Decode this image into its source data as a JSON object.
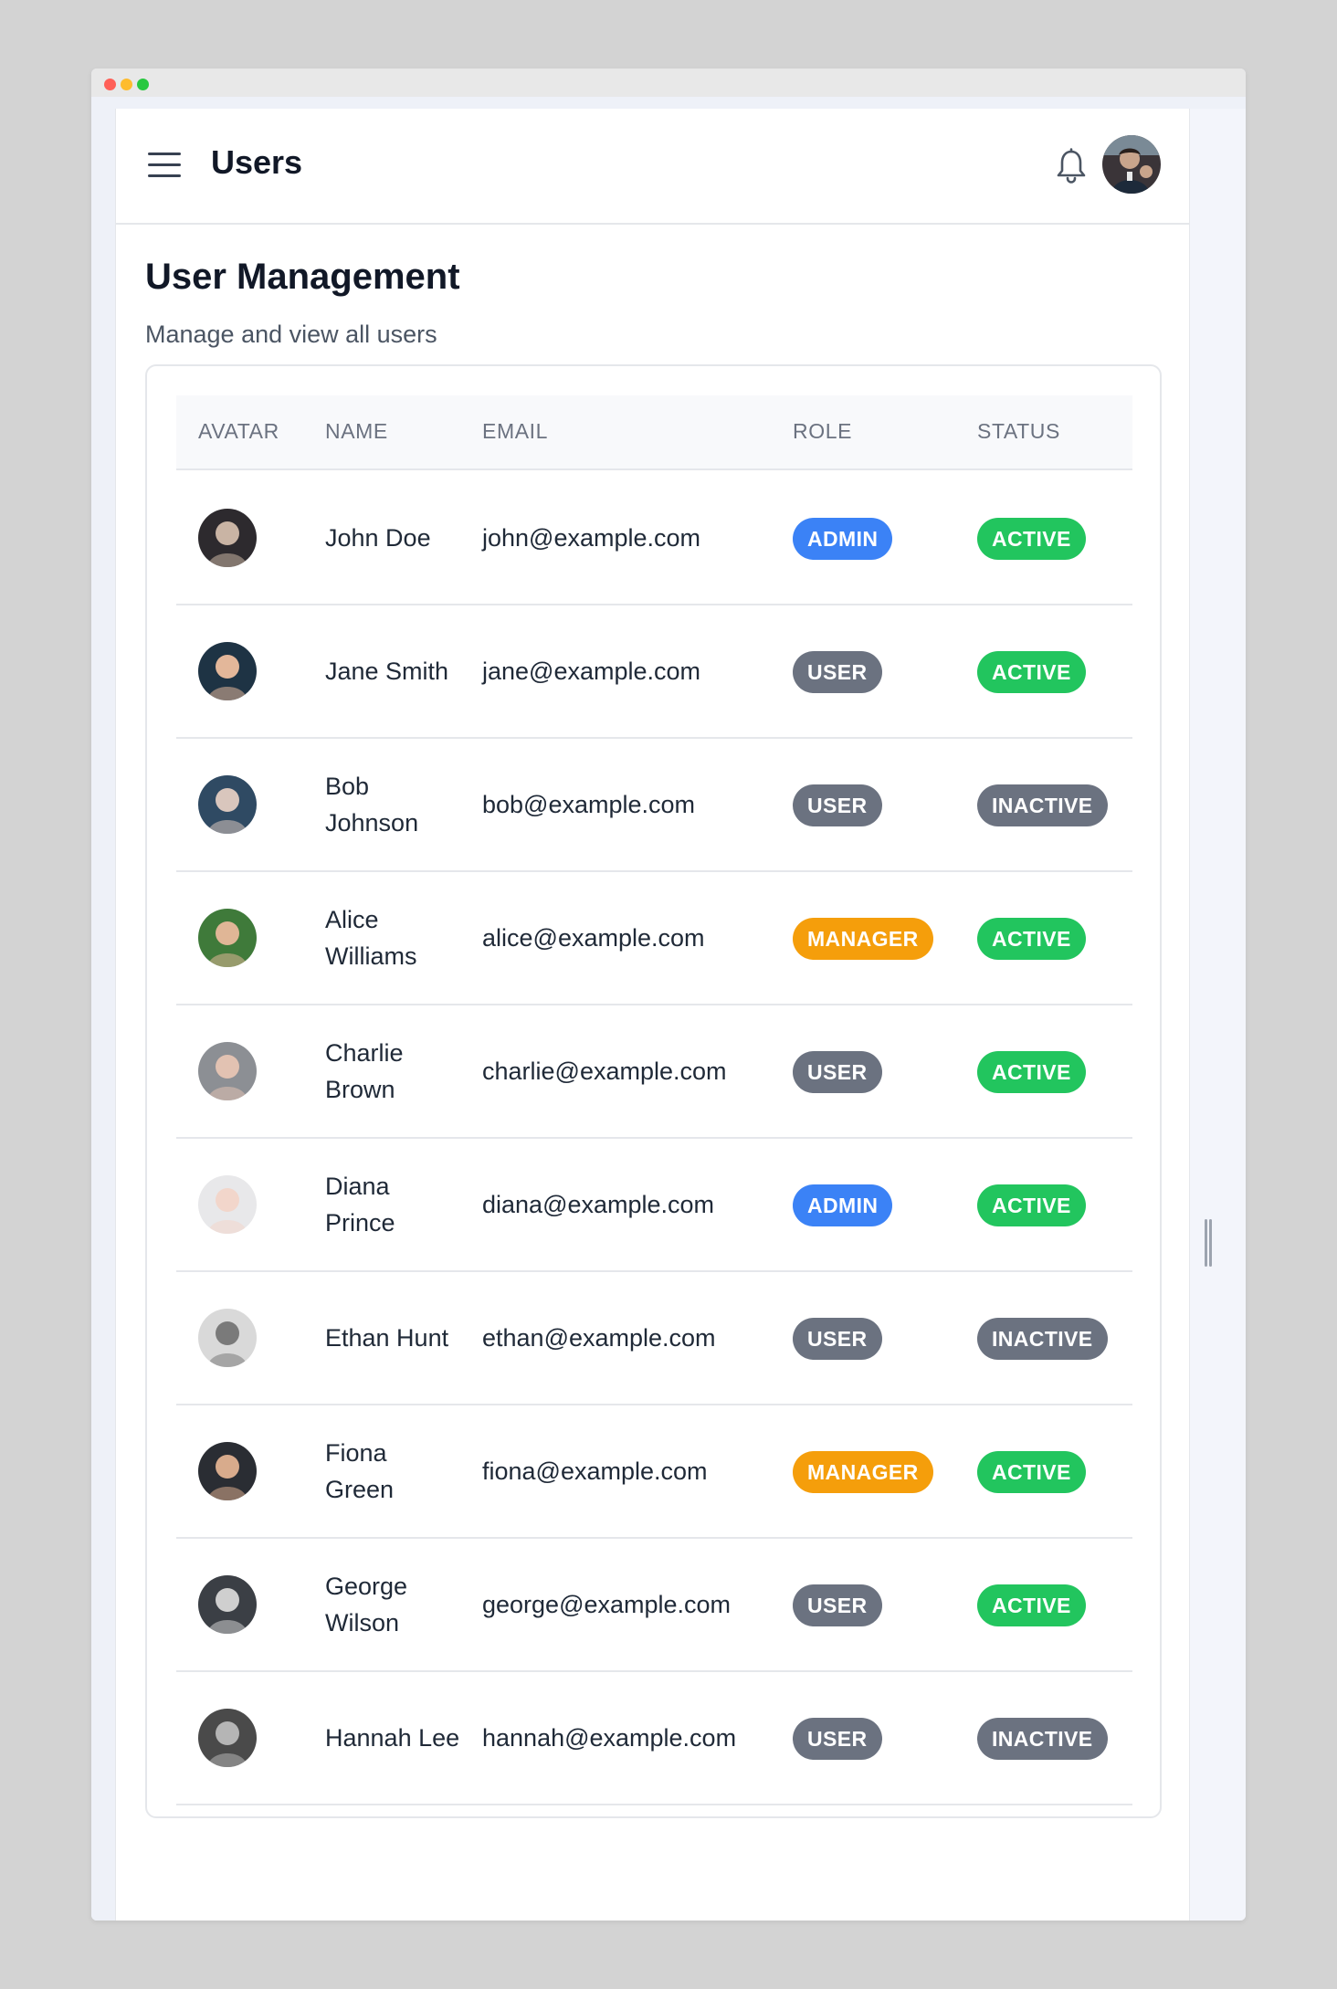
{
  "header": {
    "title": "Users",
    "menu_icon": "hamburger-menu-icon",
    "notification_icon": "bell-icon",
    "avatar_icon": "user-avatar"
  },
  "page": {
    "title": "User Management",
    "subtitle": "Manage and view all users"
  },
  "table": {
    "columns": [
      "AVATAR",
      "NAME",
      "EMAIL",
      "ROLE",
      "STATUS"
    ],
    "rows": [
      {
        "name": "John Doe",
        "email": "john@example.com",
        "role": "ADMIN",
        "status": "ACTIVE"
      },
      {
        "name": "Jane Smith",
        "email": "jane@example.com",
        "role": "USER",
        "status": "ACTIVE"
      },
      {
        "name": "Bob Johnson",
        "email": "bob@example.com",
        "role": "USER",
        "status": "INACTIVE"
      },
      {
        "name": "Alice Williams",
        "email": "alice@example.com",
        "role": "MANAGER",
        "status": "ACTIVE"
      },
      {
        "name": "Charlie Brown",
        "email": "charlie@example.com",
        "role": "USER",
        "status": "ACTIVE"
      },
      {
        "name": "Diana Prince",
        "email": "diana@example.com",
        "role": "ADMIN",
        "status": "ACTIVE"
      },
      {
        "name": "Ethan Hunt",
        "email": "ethan@example.com",
        "role": "USER",
        "status": "INACTIVE"
      },
      {
        "name": "Fiona Green",
        "email": "fiona@example.com",
        "role": "MANAGER",
        "status": "ACTIVE"
      },
      {
        "name": "George Wilson",
        "email": "george@example.com",
        "role": "USER",
        "status": "ACTIVE"
      },
      {
        "name": "Hannah Lee",
        "email": "hannah@example.com",
        "role": "USER",
        "status": "INACTIVE"
      }
    ]
  },
  "colors": {
    "ADMIN": "#3b82f6",
    "USER": "#6b7280",
    "MANAGER": "#f59e0b",
    "ACTIVE": "#22c55e",
    "INACTIVE": "#6b7280"
  },
  "avatar_palettes": [
    [
      "#2d2a2e",
      "#c9b4a4"
    ],
    [
      "#1e3344",
      "#e3b79a"
    ],
    [
      "#2f4a63",
      "#d9c6bd"
    ],
    [
      "#3f7a3a",
      "#e0b696"
    ],
    [
      "#8c8f94",
      "#e2c2b2"
    ],
    [
      "#e8e8ea",
      "#f2d6cb"
    ],
    [
      "#d9d9d9",
      "#7a7a7a"
    ],
    [
      "#2a2d33",
      "#d8ab8c"
    ],
    [
      "#3b3f45",
      "#cfcfcf"
    ],
    [
      "#4a4a4a",
      "#b5b5b5"
    ]
  ]
}
